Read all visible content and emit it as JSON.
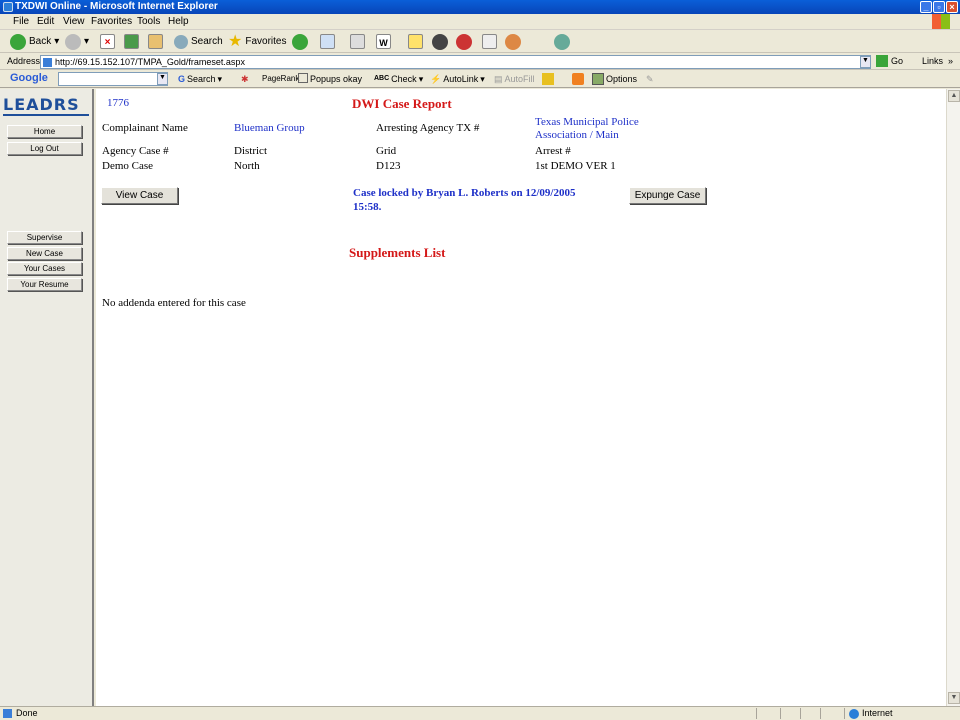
{
  "window": {
    "title": "TXDWI Online - Microsoft Internet Explorer"
  },
  "menu": [
    "File",
    "Edit",
    "View",
    "Favorites",
    "Tools",
    "Help"
  ],
  "toolbar": {
    "back": "Back",
    "search": "Search",
    "favorites": "Favorites"
  },
  "address": {
    "label": "Address",
    "url": "http://69.15.152.107/TMPA_Gold/frameset.aspx",
    "go": "Go",
    "links": "Links"
  },
  "google_bar": {
    "logo": "Google",
    "search": "Search",
    "pagerank": "PageRank",
    "popups": "Popups okay",
    "check": "Check",
    "autolink": "AutoLink",
    "autofill": "AutoFill",
    "options": "Options"
  },
  "sidebar": {
    "logo": "LEADRS",
    "top_buttons": [
      "Home",
      "Log Out"
    ],
    "buttons": [
      "Supervise",
      "New Case",
      "Your Cases",
      "Your Resume"
    ]
  },
  "report": {
    "case_number": "1776",
    "title": "DWI Case Report",
    "complainant_label": "Complainant Name",
    "complainant_value": "Blueman Group",
    "agency_label": "Arresting Agency TX #",
    "agency_value_line1": "Texas Municipal Police",
    "agency_value_line2": "Association / Main",
    "row2": [
      "Agency Case #",
      "District",
      "Grid",
      "Arrest #"
    ],
    "row3": [
      "Demo Case",
      "North",
      "D123",
      "1st DEMO VER 1"
    ],
    "view_button": "View Case",
    "lock_line1": "Case locked by Bryan L. Roberts on 12/09/2005",
    "lock_line2": "15:58.",
    "expunge_button": "Expunge Case",
    "supplements_title": "Supplements List",
    "no_addenda": "No addenda entered for this case"
  },
  "status": {
    "left": "Done",
    "zone": "Internet"
  }
}
